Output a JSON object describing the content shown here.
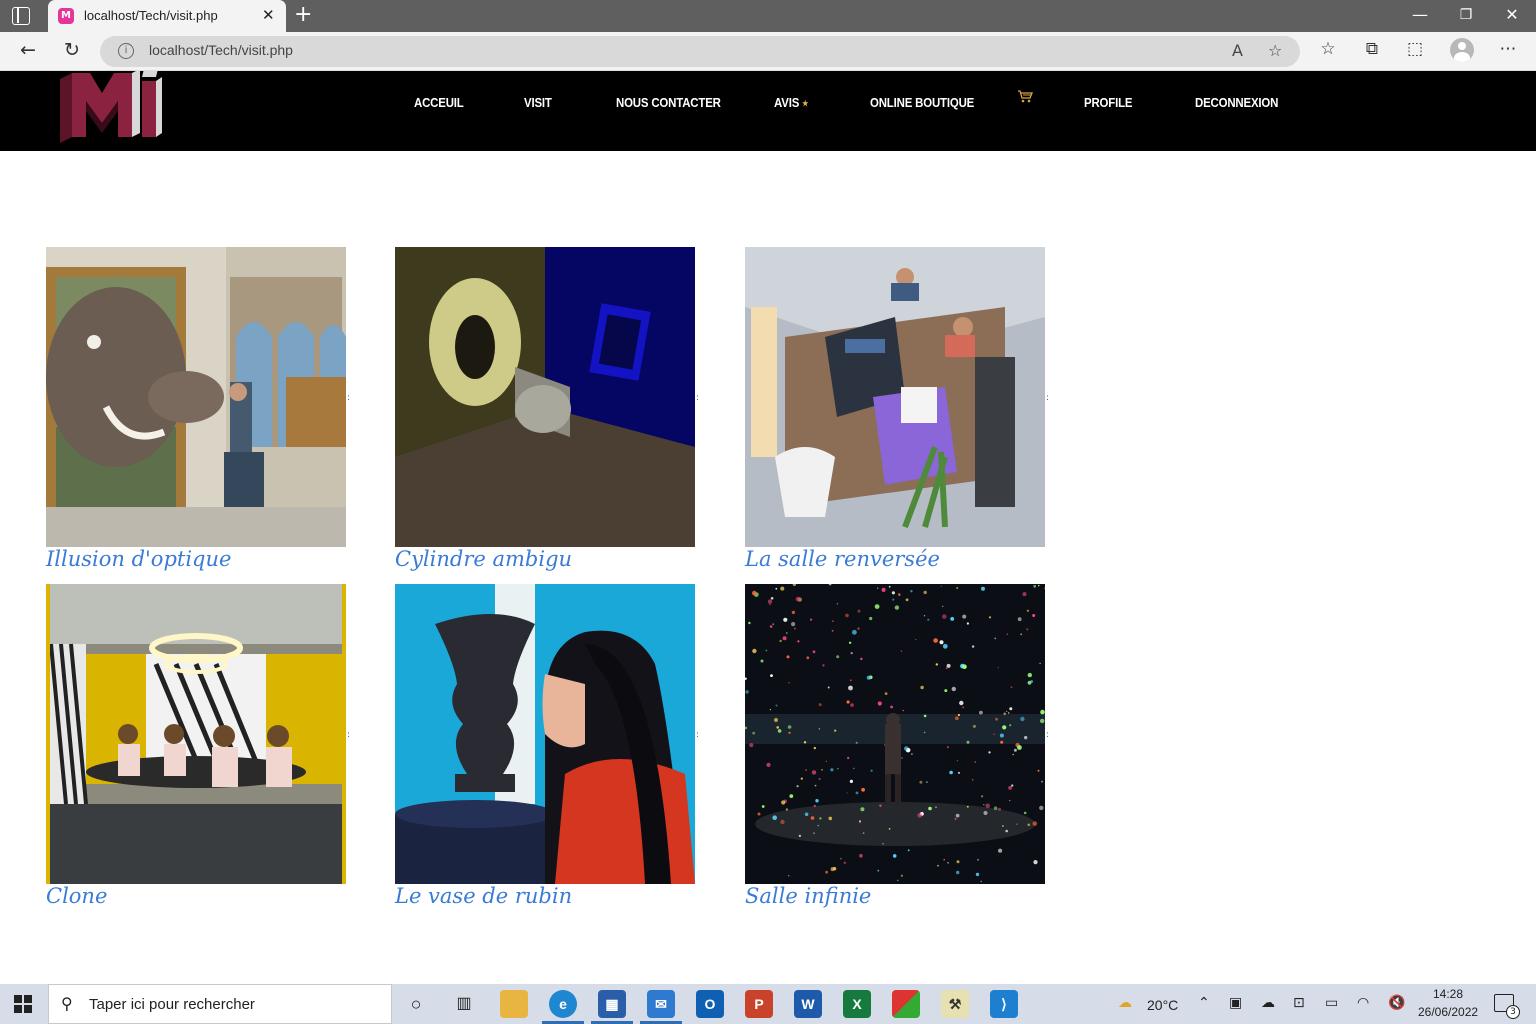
{
  "browser": {
    "tab_title": "localhost/Tech/visit.php",
    "tab_favicon_letter": "M",
    "url": "localhost/Tech/visit.php"
  },
  "site": {
    "nav": [
      {
        "label": "ACCEUIL"
      },
      {
        "label": "VISIT"
      },
      {
        "label": "NOUS CONTACTER"
      },
      {
        "label": "AVIS"
      },
      {
        "label": "ONLINE BOUTIQUE"
      },
      {
        "label": "PROFILE"
      },
      {
        "label": "DECONNEXION"
      }
    ],
    "avis_marker": "★",
    "logo_colors": {
      "front": "#8b2240",
      "side": "#d8d8d8"
    },
    "cart_icon": "cart-icon",
    "caption_color": "#3a7bd5"
  },
  "gallery": {
    "items": [
      {
        "caption": "Illusion d'optique"
      },
      {
        "caption": "Cylindre ambigu"
      },
      {
        "caption": "La salle renversée"
      },
      {
        "caption": "Clone"
      },
      {
        "caption": "Le vase de rubin"
      },
      {
        "caption": "Salle infinie"
      }
    ],
    "tick_mark": ":"
  },
  "taskbar": {
    "search_placeholder": "Taper ici pour rechercher",
    "weather": "20°C",
    "time": "14:28",
    "date": "26/06/2022",
    "notification_count": "3"
  }
}
